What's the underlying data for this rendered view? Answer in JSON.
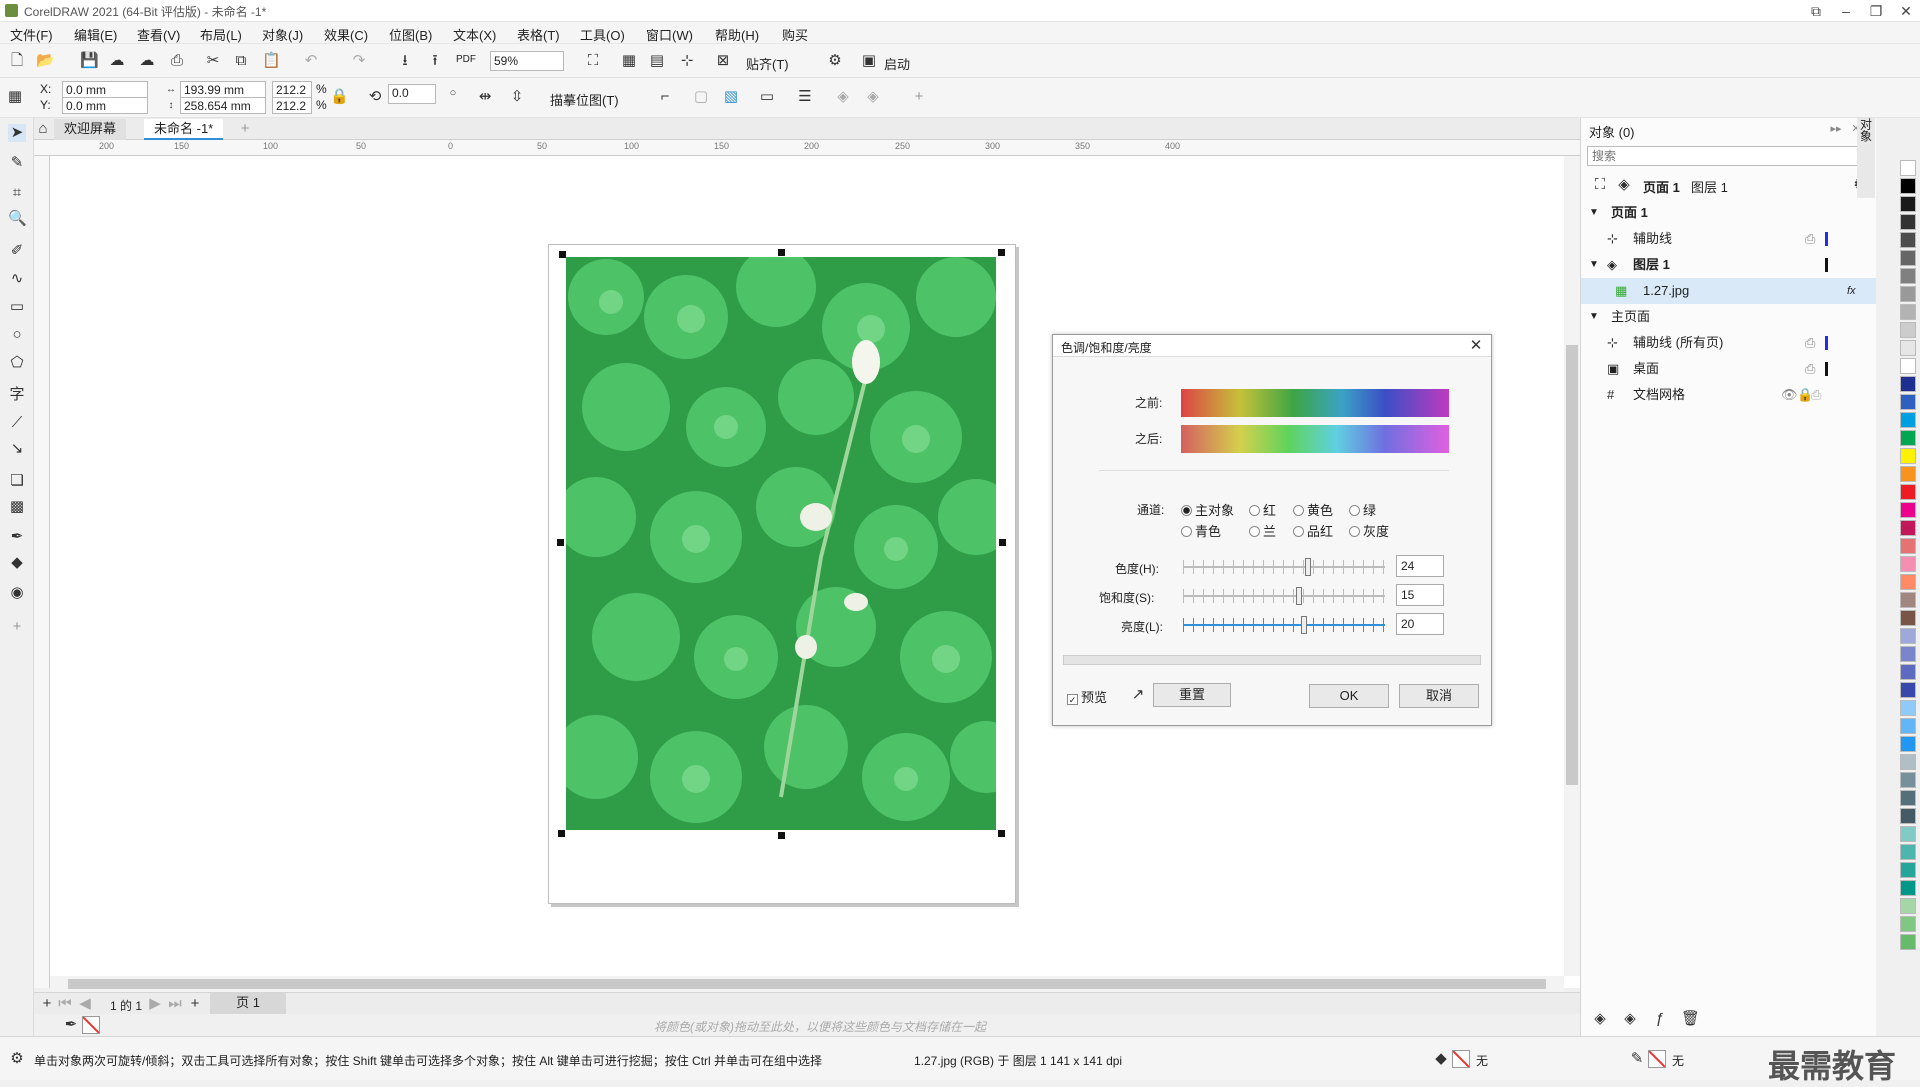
{
  "window": {
    "title": "CorelDRAW 2021 (64-Bit 评估版) - 未命名 -1*"
  },
  "menu": [
    "文件(F)",
    "编辑(E)",
    "查看(V)",
    "布局(L)",
    "对象(J)",
    "效果(C)",
    "位图(B)",
    "文本(X)",
    "表格(T)",
    "工具(O)",
    "窗口(W)",
    "帮助(H)",
    "购买"
  ],
  "toolbar": {
    "zoom": "59%",
    "snap_label": "贴齐(T)",
    "launch_label": "启动",
    "pdf": "PDF"
  },
  "props": {
    "x_label": "X:",
    "y_label": "Y:",
    "x": "0.0 mm",
    "y": "0.0 mm",
    "w": "193.99 mm",
    "h": "258.654 mm",
    "sx": "212.2",
    "sy": "212.2",
    "pct": "%",
    "angle": "0.0",
    "trace_label": "描摹位图(T)"
  },
  "tabs": {
    "welcome": "欢迎屏幕",
    "doc": "未命名 -1*"
  },
  "ruler": [
    "200",
    "150",
    "100",
    "50",
    "0",
    "50",
    "100",
    "150",
    "200",
    "250",
    "300",
    "350",
    "400"
  ],
  "pagebar": {
    "page_info": "1 的 1",
    "page_tab": "页 1"
  },
  "colorbar": {
    "hint": "将颜色(或对象)拖动至此处，以便将这些颜色与文档存储在一起"
  },
  "status": {
    "hint": "单击对象两次可旋转/倾斜；双击工具可选择所有对象；按住 Shift 键单击可选择多个对象；按住 Alt 键单击可进行挖掘；按住 Ctrl 并单击可在组中选择",
    "info": "1.27.jpg (RGB) 于 图层 1 141 x 141 dpi",
    "fill": "无",
    "outline": "无",
    "watermark": "最需教育"
  },
  "objects_panel": {
    "title": "对象 (0)",
    "search_placeholder": "搜索",
    "crumb_page": "页面 1",
    "crumb_layer": "图层 1",
    "side_tab": "对象",
    "rows": [
      {
        "label": "页面 1",
        "level": 0,
        "bold": true
      },
      {
        "label": "辅助线",
        "level": 1
      },
      {
        "label": "图层 1",
        "level": 1,
        "bold": true
      },
      {
        "label": "1.27.jpg",
        "level": 2,
        "selected": true
      },
      {
        "label": "主页面",
        "level": 0
      },
      {
        "label": "辅助线 (所有页)",
        "level": 1
      },
      {
        "label": "桌面",
        "level": 1
      },
      {
        "label": "文档网格",
        "level": 1
      }
    ]
  },
  "dialog": {
    "title": "色调/饱和度/亮度",
    "before": "之前:",
    "after": "之后:",
    "channel_label": "通道:",
    "channels": [
      "主对象",
      "红",
      "黄色",
      "绿",
      "青色",
      "兰",
      "品红",
      "灰度"
    ],
    "hue_label": "色度(H):",
    "sat_label": "饱和度(S):",
    "bri_label": "亮度(L):",
    "hue": 24,
    "sat": 15,
    "bri": 20,
    "preview": "预览",
    "reset": "重置",
    "ok": "OK",
    "cancel": "取消"
  },
  "colors": {
    "accent": "#2f8fd8",
    "selection": "#d9e9f8",
    "palette": [
      "#ffffff",
      "#000000",
      "#1a1a1a",
      "#333333",
      "#4d4d4d",
      "#666666",
      "#808080",
      "#999999",
      "#b3b3b3",
      "#cccccc",
      "#e6e6e6",
      "#ffffff",
      "#1f2f8f",
      "#2f5fc0",
      "#00a0e0",
      "#00a651",
      "#fff200",
      "#f7941d",
      "#ed1c24",
      "#ec008c",
      "#c2185b",
      "#e57373",
      "#f48fb1",
      "#ff8a65",
      "#a1887f",
      "#795548",
      "#9fa8da",
      "#7986cb",
      "#5c6bc0",
      "#3949ab",
      "#90caf9",
      "#64b5f6",
      "#2196f3",
      "#b0bec5",
      "#78909c",
      "#546e7a",
      "#455a64",
      "#80cbc4",
      "#4db6ac",
      "#26a69a",
      "#009688",
      "#a5d6a7",
      "#81c784",
      "#66bb6a"
    ]
  }
}
